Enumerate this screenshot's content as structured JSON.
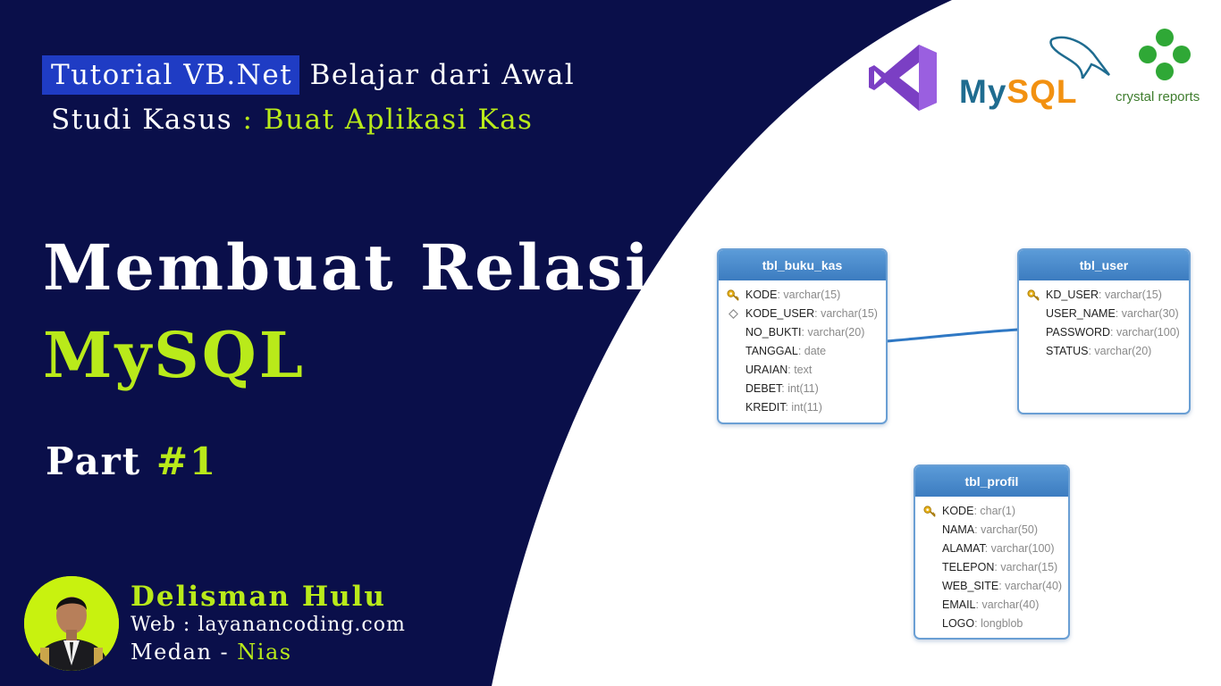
{
  "header": {
    "highlight": "Tutorial VB.Net",
    "line1_rest": "Belajar dari Awal",
    "line2_label": "Studi Kasus",
    "line2_sep": " : ",
    "line2_value": "Buat Aplikasi Kas"
  },
  "title": {
    "line1": "Membuat Relasi",
    "line2": "MySQL",
    "part_label": "Part",
    "part_number": "#1"
  },
  "author": {
    "name": "Delisman Hulu",
    "web": "Web : layanancoding.com",
    "city": "Medan",
    "sep": " - ",
    "region": "Nias"
  },
  "logos": {
    "mysql_my": "My",
    "mysql_sql": "SQL",
    "crystal": "crystal reports",
    "icons": [
      "visual-studio-logo",
      "mysql-dolphin-logo",
      "crystal-reports-logo"
    ]
  },
  "er_diagram": {
    "tables": [
      {
        "name": "tbl_buku_kas",
        "columns": [
          {
            "name": "KODE",
            "type": "varchar(15)",
            "icon": "key"
          },
          {
            "name": "KODE_USER",
            "type": "varchar(15)",
            "icon": "diamond"
          },
          {
            "name": "NO_BUKTI",
            "type": "varchar(20)",
            "icon": ""
          },
          {
            "name": "TANGGAL",
            "type": "date",
            "icon": ""
          },
          {
            "name": "URAIAN",
            "type": "text",
            "icon": ""
          },
          {
            "name": "DEBET",
            "type": "int(11)",
            "icon": ""
          },
          {
            "name": "KREDIT",
            "type": "int(11)",
            "icon": ""
          }
        ]
      },
      {
        "name": "tbl_user",
        "columns": [
          {
            "name": "KD_USER",
            "type": "varchar(15)",
            "icon": "key"
          },
          {
            "name": "USER_NAME",
            "type": "varchar(30)",
            "icon": ""
          },
          {
            "name": "PASSWORD",
            "type": "varchar(100)",
            "icon": ""
          },
          {
            "name": "STATUS",
            "type": "varchar(20)",
            "icon": ""
          }
        ]
      },
      {
        "name": "tbl_profil",
        "columns": [
          {
            "name": "KODE",
            "type": "char(1)",
            "icon": "key"
          },
          {
            "name": "NAMA",
            "type": "varchar(50)",
            "icon": ""
          },
          {
            "name": "ALAMAT",
            "type": "varchar(100)",
            "icon": ""
          },
          {
            "name": "TELEPON",
            "type": "varchar(15)",
            "icon": ""
          },
          {
            "name": "WEB_SITE",
            "type": "varchar(40)",
            "icon": ""
          },
          {
            "name": "EMAIL",
            "type": "varchar(40)",
            "icon": ""
          },
          {
            "name": "LOGO",
            "type": "longblob",
            "icon": ""
          }
        ]
      }
    ],
    "relations": [
      {
        "from": "tbl_buku_kas",
        "to": "tbl_user"
      }
    ]
  },
  "colors": {
    "background_dark": "#0a0f4a",
    "accent_green": "#b9ea1a",
    "highlight_blue": "#1f3cc4",
    "table_header": "#4a8bcc",
    "relation_line": "#2f78c4"
  }
}
